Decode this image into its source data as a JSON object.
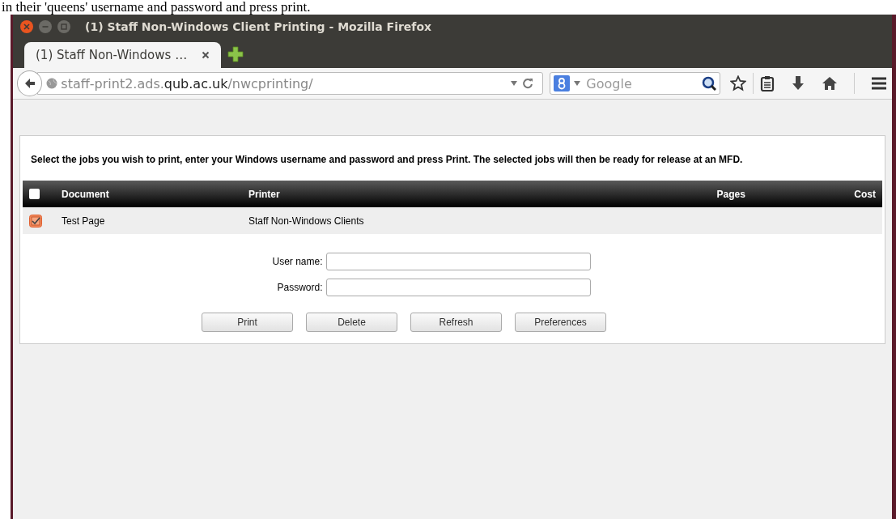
{
  "document_text": "in their 'queens' username and password and press print.",
  "window": {
    "title": "(1) Staff Non-Windows Client Printing - Mozilla Firefox"
  },
  "tabs": [
    {
      "label": "(1) Staff Non-Windows …",
      "selected": true
    }
  ],
  "url": {
    "prefix": "staff-print2.ads.",
    "domain": "qub.ac.uk",
    "path": "/nwcprinting/"
  },
  "search": {
    "placeholder": "Google"
  },
  "page": {
    "instructions": "Select the jobs you wish to print, enter your Windows username and password and press Print. The selected jobs will then be ready for release at an MFD.",
    "table": {
      "select_all_checked": false,
      "columns": [
        "Document",
        "Printer",
        "Pages",
        "Cost"
      ],
      "rows": [
        {
          "checked": true,
          "cells": [
            "Test Page",
            "Staff Non-Windows Clients"
          ]
        }
      ]
    },
    "fields": [
      {
        "label": "User name:"
      },
      {
        "label": "Password:"
      }
    ],
    "buttons": [
      "Print",
      "Delete",
      "Refresh",
      "Preferences"
    ]
  }
}
